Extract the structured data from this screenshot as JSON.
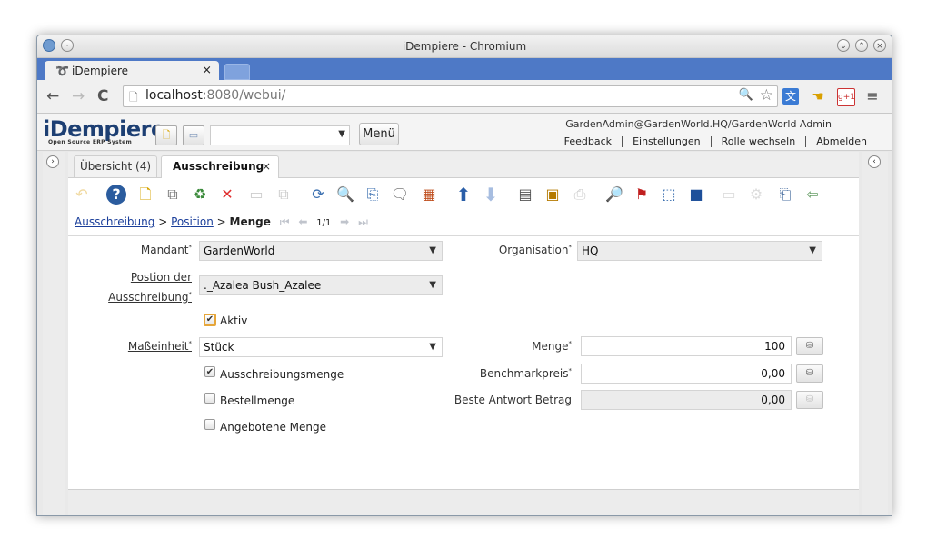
{
  "browser": {
    "window_title": "iDempiere - Chromium",
    "tab_title": "iDempiere",
    "tab_close": "×",
    "url_host": "localhost",
    "url_rest": ":8080/webui/"
  },
  "header": {
    "logo": "iDempiere",
    "logo_sub": "Open Source ERP System",
    "menu_button": "Menü",
    "user_info": "GardenAdmin@GardenWorld.HQ/GardenWorld Admin",
    "links": [
      "Feedback",
      "Einstellungen",
      "Rolle wechseln",
      "Abmelden"
    ]
  },
  "window_tabs": {
    "overview": "Übersicht (4)",
    "active": "Ausschreibung",
    "active_close": "×"
  },
  "breadcrumb": {
    "link1": "Ausschreibung",
    "sep1": ">",
    "link2": "Position",
    "sep2": ">",
    "current": "Menge",
    "record_pos": "1/1"
  },
  "form": {
    "mandant_label": "Mandant",
    "mandant_value": "GardenWorld",
    "organisation_label": "Organisation",
    "organisation_value": "HQ",
    "position_label_1": "Postion der",
    "position_label_2": "Ausschreibung",
    "position_value": "._Azalea Bush_Azalee",
    "aktiv_label": "Aktiv",
    "masseinheit_label": "Maßeinheit",
    "masseinheit_value": "Stück",
    "menge_label": "Menge",
    "menge_value": "100",
    "ausschreibungsmenge_label": "Ausschreibungsmenge",
    "benchmarkpreis_label": "Benchmarkpreis",
    "benchmarkpreis_value": "0,00",
    "bestellmenge_label": "Bestellmenge",
    "beste_antwort_label": "Beste Antwort Betrag",
    "beste_antwort_value": "0,00",
    "angebotene_menge_label": "Angebotene Menge",
    "required_mark": "*"
  },
  "checkboxes": {
    "aktiv": true,
    "ausschreibungsmenge": true,
    "bestellmenge": false,
    "angebotene_menge": false
  }
}
